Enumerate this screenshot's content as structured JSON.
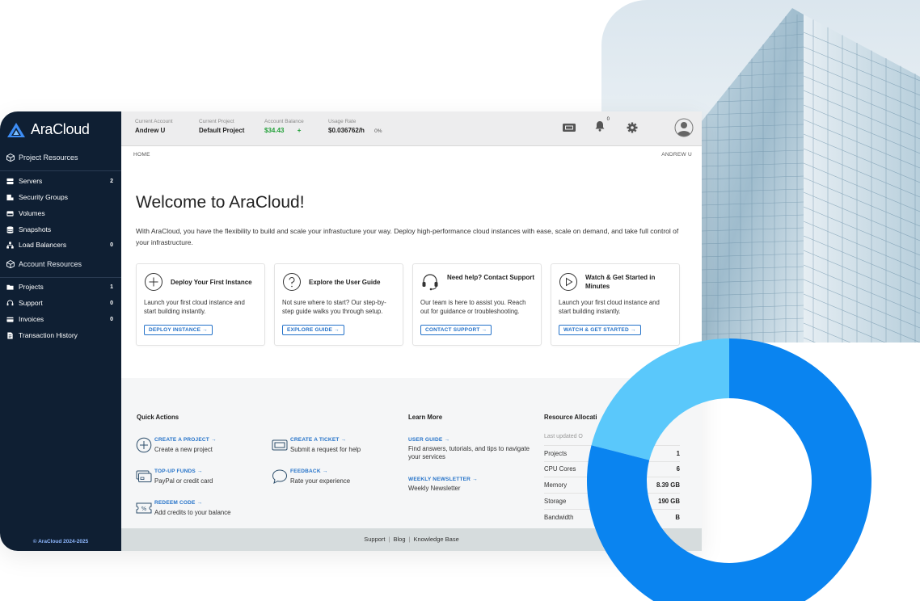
{
  "app": {
    "brand": "AraCloud",
    "copyright": "© AraCloud 2024-2025"
  },
  "sidebar": {
    "sections": [
      {
        "label": "Project Resources",
        "icon": "cube-icon"
      },
      {
        "label": "Account Resources",
        "icon": "cube-icon"
      }
    ],
    "project_items": [
      {
        "label": "Servers",
        "count": "2",
        "icon": "server-icon"
      },
      {
        "label": "Security Groups",
        "count": "",
        "icon": "shield-icon"
      },
      {
        "label": "Volumes",
        "count": "",
        "icon": "disk-icon"
      },
      {
        "label": "Snapshots",
        "count": "",
        "icon": "database-icon"
      },
      {
        "label": "Load Balancers",
        "count": "0",
        "icon": "network-icon"
      }
    ],
    "account_items": [
      {
        "label": "Projects",
        "count": "1",
        "icon": "folder-icon"
      },
      {
        "label": "Support",
        "count": "0",
        "icon": "support-icon"
      },
      {
        "label": "Invoices",
        "count": "0",
        "icon": "invoice-icon"
      },
      {
        "label": "Transaction History",
        "count": "",
        "icon": "document-icon"
      }
    ]
  },
  "topbar": {
    "current_account_label": "Current Account",
    "current_account": "Andrew U",
    "current_project_label": "Current Project",
    "current_project": "Default Project",
    "balance_label": "Account Balance",
    "balance": "$34.43",
    "balance_add": "+",
    "usage_label": "Usage Rate",
    "usage": "$0.036762/h",
    "usage_pct": "0%",
    "notification_count": "0"
  },
  "breadcrumb": {
    "home": "HOME",
    "user": "ANDREW U"
  },
  "welcome": {
    "title": "Welcome to AraCloud!",
    "description": "With AraCloud, you have the flexibility to build and scale your infrastucture your way. Deploy high-performance cloud instances with ease, scale on demand, and take full control of your infrastructure."
  },
  "cards": [
    {
      "title": "Deploy Your First Instance",
      "desc": "Launch your first cloud instance and start building instantly.",
      "button": "DEPLOY INSTANCE →",
      "icon": "plus-circle-icon"
    },
    {
      "title": "Explore the User Guide",
      "desc": "Not sure where to start? Our step-by-step guide walks you through setup.",
      "button": "EXPLORE GUIDE →",
      "icon": "question-circle-icon"
    },
    {
      "title": "Need help? Contact Support",
      "desc": "Our team is here to assist you. Reach out for guidance or troubleshooting.",
      "button": "CONTACT SUPPORT →",
      "icon": "headset-icon"
    },
    {
      "title": "Watch & Get Started in Minutes",
      "desc": "Launch your first cloud instance and start building instantly.",
      "button": "WATCH & GET STARTED →",
      "icon": "play-circle-icon"
    }
  ],
  "quick_actions": {
    "heading": "Quick Actions",
    "items": [
      {
        "link": "CREATE A PROJECT →",
        "desc": "Create a new project",
        "icon": "plus-circle-icon"
      },
      {
        "link": "CREATE A TICKET →",
        "desc": "Submit a request for help",
        "icon": "ticket-icon"
      },
      {
        "link": "TOP-UP FUNDS →",
        "desc": "PayPal or credit card",
        "icon": "wallet-icon"
      },
      {
        "link": "FEEDBACK →",
        "desc": "Rate your experience",
        "icon": "chat-icon"
      },
      {
        "link": "REDEEM CODE →",
        "desc": "Add credits to your balance",
        "icon": "coupon-icon"
      }
    ]
  },
  "learn_more": {
    "heading": "Learn More",
    "items": [
      {
        "link": "USER GUIDE →",
        "desc": "Find answers, tutorials, and tips to navigate your services"
      },
      {
        "link": "WEEKLY NEWSLETTER →",
        "desc": "Weekly Newsletter"
      }
    ]
  },
  "resources": {
    "heading": "Resource Allocati",
    "updated": "Last updated O",
    "rows": [
      {
        "key": "Projects",
        "value": "1"
      },
      {
        "key": "CPU Cores",
        "value": "6"
      },
      {
        "key": "Memory",
        "value": "8.39 GB"
      },
      {
        "key": "Storage",
        "value": "190 GB"
      },
      {
        "key": "Bandwidth",
        "value": "B"
      }
    ]
  },
  "footer": {
    "links": [
      "Support",
      "Blog",
      "Knowledge Base"
    ]
  },
  "donut": {
    "fraction_dark": 0.79,
    "color_dark": "#0a84f0",
    "color_light": "#5ac8fb"
  }
}
